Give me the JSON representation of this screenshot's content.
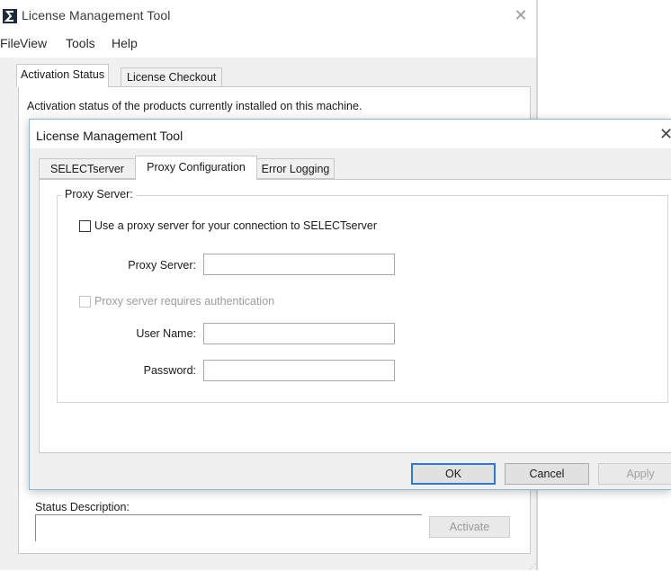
{
  "background_window": {
    "title": "License Management Tool",
    "close_glyph": "✕",
    "menu": [
      "File",
      "View",
      "Tools",
      "Help"
    ],
    "tabs": [
      "Activation Status",
      "License Checkout"
    ],
    "activation_description": "Activation status of the products currently installed on this machine.",
    "status_description_label": "Status Description:",
    "status_description_value": "",
    "activate_label": "Activate"
  },
  "dialog": {
    "title": "License Management Tool",
    "close_glyph": "✕",
    "tabs": [
      "SELECTserver",
      "Proxy Configuration",
      "Error Logging"
    ],
    "active_tab": "Proxy Configuration",
    "group_label": "Proxy Server:",
    "use_proxy_label": "Use a proxy server for your connection to SELECTserver",
    "use_proxy_checked": false,
    "proxy_server_label": "Proxy Server:",
    "proxy_server_value": "",
    "auth_label": "Proxy server requires authentication",
    "auth_checked": false,
    "user_name_label": "User Name:",
    "user_name_value": "",
    "password_label": "Password:",
    "password_value": "",
    "buttons": {
      "ok": "OK",
      "cancel": "Cancel",
      "apply": "Apply"
    }
  },
  "colors": {
    "default_button_border": "#2e7ad1",
    "dialog_border": "#8db4dc",
    "disabled_text": "#9c9c9c"
  },
  "icons": {
    "app": "bentley-s-icon",
    "close": "close-icon",
    "grip": "resize-grip-icon"
  }
}
